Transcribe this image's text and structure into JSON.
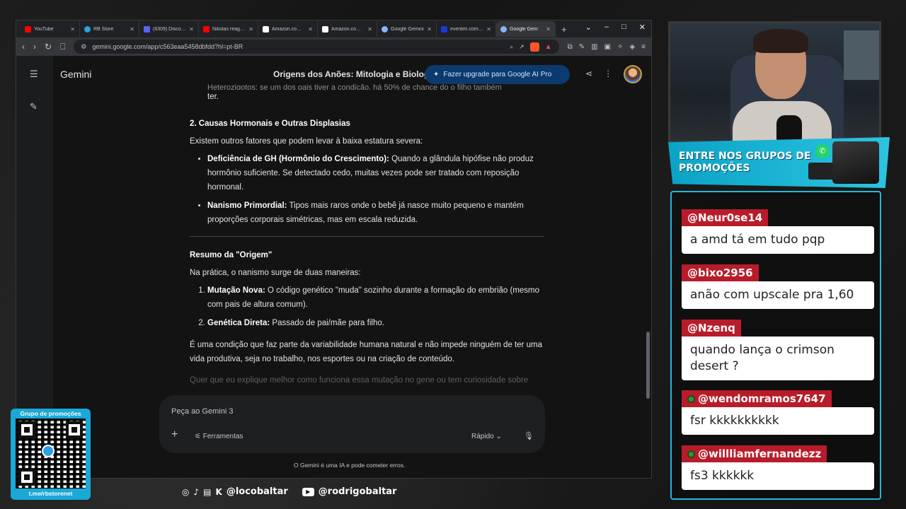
{
  "browser": {
    "tabs": [
      {
        "label": "YouTube",
        "color": "#ff0000",
        "active": false
      },
      {
        "label": "RB Store",
        "color": "#2aa3e0",
        "active": false
      },
      {
        "label": "(6309) Discord | #",
        "color": "#5865f2",
        "active": false
      },
      {
        "label": "Nikolas reage ap",
        "color": "#ff0000",
        "active": false
      },
      {
        "label": "Amazon.com.br",
        "color": "#ffffff",
        "active": false
      },
      {
        "label": "Amazon.com.br",
        "color": "#ffffff",
        "active": false
      },
      {
        "label": "Google Gemini",
        "color": "#8ab4f8",
        "active": false
      },
      {
        "label": "eventim.com.br",
        "color": "#1a3ad8",
        "active": false
      },
      {
        "label": "Google Gem",
        "color": "#8ab4f8",
        "active": true
      }
    ],
    "url": "gemini.google.com/app/c563eaa5458dbfdd?hl=pt-BR"
  },
  "gemini": {
    "brand": "Gemini",
    "chat_title": "Origens dos Anões: Mitologia e Biologia",
    "upgrade_label": "Fazer upgrade para Google AI Pro",
    "content": {
      "partial_top": "Heterozigotos: se um dos pais tiver a condição, há 50% de chance do o filho também",
      "partial_top_end": "ter.",
      "section2_title": "2. Causas Hormonais e Outras Displasias",
      "section2_intro": "Existem outros fatores que podem levar à baixa estatura severa:",
      "bullets": [
        {
          "bold": "Deficiência de GH (Hormônio do Crescimento):",
          "text": " Quando a glândula hipófise não produz hormônio suficiente. Se detectado cedo, muitas vezes pode ser tratado com reposição hormonal."
        },
        {
          "bold": "Nanismo Primordial:",
          "text": " Tipos mais raros onde o bebê já nasce muito pequeno e mantém proporções corporais simétricas, mas em escala reduzida."
        }
      ],
      "summary_title": "Resumo da \"Origem\"",
      "summary_intro": "Na prática, o nanismo surge de duas maneiras:",
      "numbered": [
        {
          "bold": "Mutação Nova:",
          "text": " O código genético \"muda\" sozinho durante a formação do embrião (mesmo com pais de altura comum)."
        },
        {
          "bold": "Genética Direta:",
          "text": " Passado de pai/mãe para filho."
        }
      ],
      "closing": "É uma condição que faz parte da variabilidade humana natural e não impede ninguém de ter uma vida produtiva, seja no trabalho, nos esportes ou na criação de conteúdo.",
      "faded": "Quer que eu explique melhor como funciona essa mutação no gene ou tem curiosidade sobre"
    },
    "prompt_placeholder": "Peça ao Gemini 3",
    "tools_label": "Ferramentas",
    "mode_label": "Rápido",
    "disclaimer": "O Gemini é uma IA e pode cometer erros."
  },
  "overlay": {
    "promo_text": "ENTRE NOS GRUPOS DE PROMOÇÕES",
    "qr_title": "Grupo de promoções",
    "qr_url": "t.me/rbstorenet",
    "social_handle_1": "@locobaltar",
    "social_handle_2": "@rodrigobaltar",
    "chat": [
      {
        "user": "@Neur0se14",
        "text": "a amd tá em tudo pqp",
        "badge": false
      },
      {
        "user": "@bixo2956",
        "text": "anão com upscale pra 1,60",
        "badge": false
      },
      {
        "user": "@Nzenq",
        "text": "quando lança o crimson desert ?",
        "badge": false
      },
      {
        "user": "@wendomramos7647",
        "text": "fsr kkkkkkkkkk",
        "badge": true
      },
      {
        "user": "@willliamfernandezz",
        "text": "fs3 kkkkkk",
        "badge": true
      }
    ]
  }
}
